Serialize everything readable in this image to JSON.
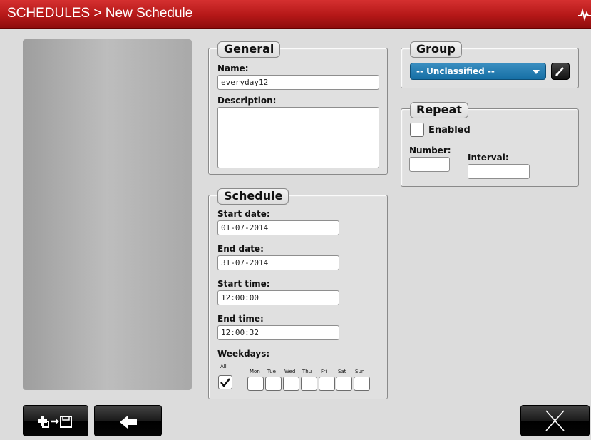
{
  "header": {
    "title": "SCHEDULES > New Schedule"
  },
  "general": {
    "legend": "General",
    "name_label": "Name:",
    "name_value": "everyday12",
    "description_label": "Description:",
    "description_value": ""
  },
  "group": {
    "legend": "Group",
    "selected": "-- Unclassified --"
  },
  "repeat": {
    "legend": "Repeat",
    "enabled_label": "Enabled",
    "enabled": false,
    "number_label": "Number:",
    "number_value": "",
    "interval_label": "Interval:",
    "interval_value": ""
  },
  "schedule": {
    "legend": "Schedule",
    "start_date_label": "Start date:",
    "start_date": "01-07-2014",
    "end_date_label": "End date:",
    "end_date": "31-07-2014",
    "start_time_label": "Start time:",
    "start_time": "12:00:00",
    "end_time_label": "End time:",
    "end_time": "12:00:32",
    "weekdays_label": "Weekdays:",
    "all_label": "All",
    "all_checked": true,
    "days": [
      "Mon",
      "Tue",
      "Wed",
      "Thu",
      "Fri",
      "Sat",
      "Sun"
    ]
  },
  "toolbar": {
    "save_icon": "save-to-disk-icon",
    "back_icon": "back-arrow-icon",
    "close_icon": "close-x-icon"
  },
  "colors": {
    "title_bar": "#b51818",
    "select_accent": "#166fa5",
    "background": "#dcdcdc"
  }
}
